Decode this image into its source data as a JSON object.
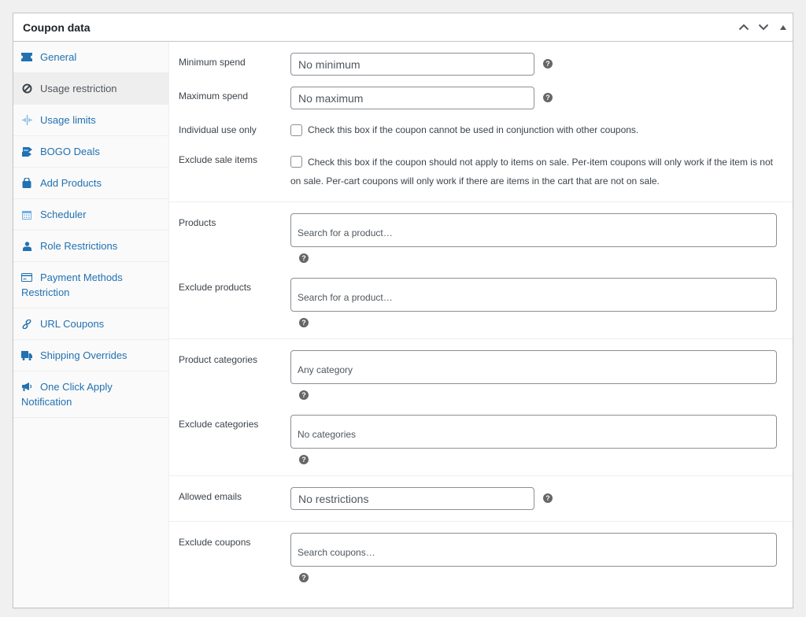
{
  "header": {
    "title": "Coupon data",
    "actions": [
      {
        "name": "move-up",
        "icon": "chevron-up-icon"
      },
      {
        "name": "move-down",
        "icon": "chevron-down-icon"
      },
      {
        "name": "toggle-panel",
        "icon": "triangle-up-icon"
      }
    ]
  },
  "tabs": [
    {
      "label": "General",
      "icon": "ticket-icon",
      "active": false
    },
    {
      "label": "Usage restriction",
      "icon": "block-icon",
      "active": true
    },
    {
      "label": "Usage limits",
      "icon": "crosshair-icon",
      "active": false
    },
    {
      "label": "BOGO Deals",
      "icon": "tag-icon",
      "active": false
    },
    {
      "label": "Add Products",
      "icon": "bag-icon",
      "active": false
    },
    {
      "label": "Scheduler",
      "icon": "calendar-icon",
      "active": false
    },
    {
      "label": "Role Restrictions",
      "icon": "user-icon",
      "active": false
    },
    {
      "label": "Payment Methods Restriction",
      "icon": "credit-card-icon",
      "active": false
    },
    {
      "label": "URL Coupons",
      "icon": "link-icon",
      "active": false
    },
    {
      "label": "Shipping Overrides",
      "icon": "truck-icon",
      "active": false
    },
    {
      "label": "One Click Apply Notification",
      "icon": "megaphone-icon",
      "active": false
    }
  ],
  "fields": {
    "minimum_spend": {
      "label": "Minimum spend",
      "placeholder": "No minimum",
      "value": ""
    },
    "maximum_spend": {
      "label": "Maximum spend",
      "placeholder": "No maximum",
      "value": ""
    },
    "individual_use": {
      "label": "Individual use only",
      "checked": false,
      "description": "Check this box if the coupon cannot be used in conjunction with other coupons."
    },
    "exclude_sale_items": {
      "label": "Exclude sale items",
      "checked": false,
      "description": "Check this box if the coupon should not apply to items on sale. Per-item coupons will only work if the item is not on sale. Per-cart coupons will only work if there are items in the cart that are not on sale."
    },
    "products": {
      "label": "Products",
      "placeholder": "Search for a product…"
    },
    "exclude_products": {
      "label": "Exclude products",
      "placeholder": "Search for a product…"
    },
    "product_categories": {
      "label": "Product categories",
      "placeholder": "Any category"
    },
    "exclude_categories": {
      "label": "Exclude categories",
      "placeholder": "No categories"
    },
    "allowed_emails": {
      "label": "Allowed emails",
      "placeholder": "No restrictions",
      "value": ""
    },
    "exclude_coupons": {
      "label": "Exclude coupons",
      "placeholder": "Search coupons…"
    }
  },
  "help_icon": "?",
  "colors": {
    "link": "#2271b1",
    "active_tab_bg": "#eeeeee",
    "border": "#c3c4c7",
    "input_border": "#8c8f94",
    "help_icon_bg": "#666666"
  }
}
